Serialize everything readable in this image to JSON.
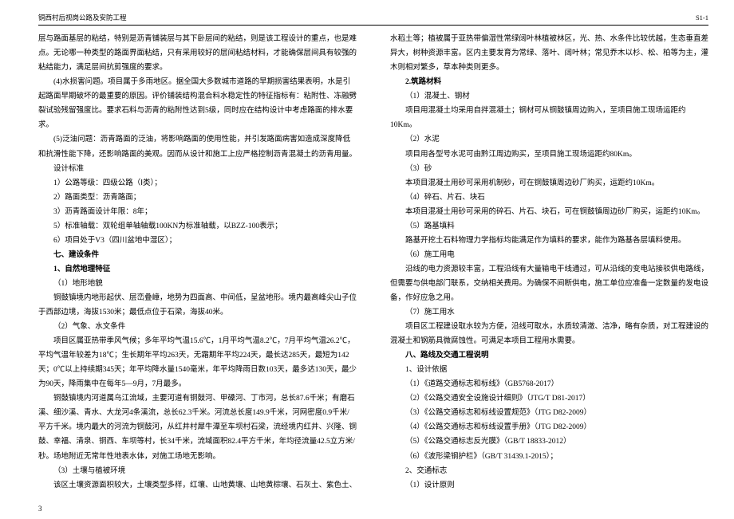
{
  "header": {
    "left": "铜西村后视岗公路及安防工程",
    "right": "S1-1"
  },
  "col1": {
    "p1": "层与路面基层的粘结，特别是沥青铺装层与其下卧层间的粘结，则是该工程设计的重点，也是难点。无论哪一种类型的路面界面粘结，只有采用较好的层间粘结材料，才能确保层间具有较强的粘结能力，满足层间抗剪强度的要求。",
    "p2": "(4)水损害问题。项目属于多雨地区。据全国大多数城市道路的早期损害结果表明，水是引起路面早期破坏的最重要的原因。评价铺装结构混合料水稳定性的特征指标有：粘附性、冻融劈裂试验残留强度比。要求石料与沥青的粘附性达到5级，同时应在结构设计中考虑路面的排水要求。",
    "p3": "(5)泛油问题：沥青路面的泛油，将影响路面的使用性能，并引发路面病害如造成深度降低和抗滑性能下降，还影响路面的美观。因而从设计和施工上应严格控制沥青混凝土的沥青用量。",
    "p4": "设计标准",
    "li1": "1）公路等级：四级公路（Ⅰ类）；",
    "li2": "2）路面类型：沥青路面；",
    "li3": "3）沥青路面设计年限：8年；",
    "li4": "5）标准轴载：双轮组单轴轴载100KN为标准轴载，以BZZ-100表示；",
    "li5": "6）项目处于V3（四川盆地中湿区）；",
    "h1": "七、建设条件",
    "h2": "1、自然地理特征",
    "s1": "（1）地形地貌",
    "p5": "铜鼓镇境内地形起伏、层峦叠嶂，地势为四面高、中间低，呈盆地形。境内最高峰尖山子位于西部边境，海拔1530米；最低点位于石梁，海拔40米。",
    "s2": "（2）气象、水文条件",
    "p6": "项目区属亚热带季风气候；多年平均气温15.6℃，1月平均气温8.2℃，7月平均气温26.2℃，平均气温年较差为18℃；生长期年平均263天，无霜期年平均224天，最长达285天，最短为142天；0℃以上持续期345天；年平均降水量1540毫米，年平均降雨日数103天，最多达130天，最少为90天，降雨集中在每年5—9月，7月最多。",
    "p7": "铜鼓镇境内河道属乌江流域，主要河道有铜鼓河、甲磉河、丁市河，总长87.6千米；有磨石溪、细沙溪、青水、大龙河4条溪流，总长62.3千米。河流总长度149.9千米，河网密度0.9千米/平方千米。境内最大的河流为铜鼓河，从红井村犀牛潭至车坝村石梁，流经境内红井、兴隆、铜鼓、幸福、清泉、铜西、车坝等村，长34千米，流域面积82.4平方千米，年均径流量42.5立方米/秒。场地附近无常年性地表水体，对施工场地无影响。",
    "s3": "（3）土壤与植被环境",
    "p8": "该区土壤资源面积较大，土壤类型多样，红壤、山地黄壤、山地黄棕壤、石灰土、紫色土、"
  },
  "col2": {
    "p1": "水稻土等；植被属于亚热带偏湿性常绿阔叶林植被林区，光、热、水条件比较优越，生态垂直差异大，树种资源丰富。区内主要发育为常绿、落叶、阔叶林；常见乔木以杉、松、柏等为主，灌木则相对繁多，草本种类则更多。",
    "h1": "2.筑路材料",
    "s1": "（1）混凝土、钢材",
    "p2": "项目用混凝土均采用自拌混凝土；钢材可从铜鼓镇周边购入，至项目施工现场运距约10Km。",
    "s2": "（2）水泥",
    "p3": "项目用各型号水泥可由黔江周边购买，至项目施工现场运距约80Km。",
    "s3": "（3）砂",
    "p4": "本项目混凝土用砂可采用机制砂，可在铜鼓镇周边砂厂购买，运距约10Km。",
    "s4": "（4）碎石、片石、块石",
    "p5": "本项目混凝土用砂可采用的碎石、片石、块石，可在铜鼓镇周边砂厂购买，运距约10Km。",
    "s5": "（5）路基填料",
    "p6": "路基开挖土石料物理力学指标均能满足作为填料的要求，能作为路基各层填料使用。",
    "s6": "（6）施工用电",
    "p7": "沿线的电力资源较丰富，工程沿线有大量输电干线通过，可从沿线的变电站接驳供电路线，但需要与供电部门联系，交纳相关费用。为确保不间断供电，施工单位应准备一定数量的发电设备，作好应急之用。",
    "s7": "（7）施工用水",
    "p8": "项目区工程建设取水较为方便，沿线可取水，水质较清澈、洁净，略有杂质，对工程建设的混凝土和钢筋具微腐蚀性。可满足本项目工程用水需要。",
    "h2": "八、路线及交通工程说明",
    "s8": "1、设计依据",
    "r1": "（1）《道路交通标志和标线》（GB5768-2017）",
    "r2": "（2）《公路交通安全设施设计细则》（JTG/T D81-2017）",
    "r3": "（3）《公路交通标志和标线设置规范》（JTG D82-2009）",
    "r4": "（4）《公路交通标志和标线设置手册》（JTG D82-2009）",
    "r5": "（5）《公路交通标志反光膜》（GB/T 18833-2012）",
    "r6": "（6）《波形梁钢护栏》（GB/T 31439.1-2015）；",
    "s9": "2、交通标志",
    "s10": "（1）设计原则"
  },
  "footer": "3"
}
